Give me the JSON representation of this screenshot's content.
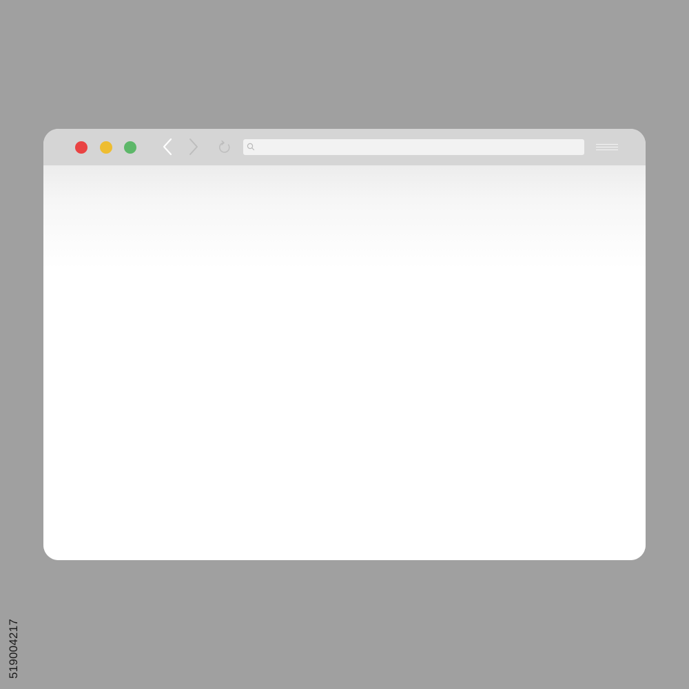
{
  "window": {
    "traffic_lights": {
      "close_color": "#e94343",
      "minimize_color": "#eebd31",
      "maximize_color": "#5db769"
    },
    "navigation": {
      "back_icon": "chevron-left-icon",
      "forward_icon": "chevron-right-icon",
      "reload_icon": "reload-icon"
    },
    "address_bar": {
      "icon": "search-icon",
      "value": "",
      "placeholder": ""
    },
    "menu_icon": "hamburger-menu-icon",
    "colors": {
      "toolbar": "#d5d5d5",
      "address_bar": "#f2f2f2",
      "content": "#ffffff",
      "desktop": "#a0a0a0"
    }
  },
  "stock_id": "519004217"
}
